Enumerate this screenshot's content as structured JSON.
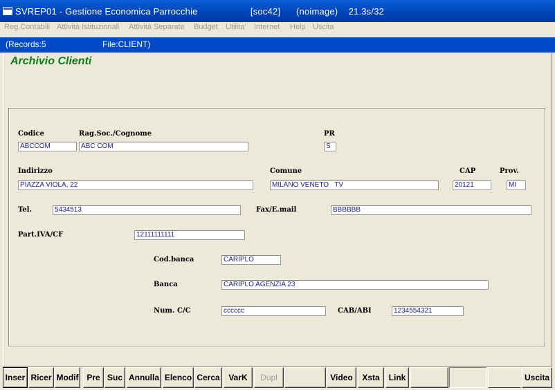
{
  "window": {
    "title": "SVREP01 - Gestione Economica Parrocchie                    [soc42]      (noimage)    21.3s/32"
  },
  "menu": [
    "Reg.Contabili",
    "Attività Istituzionali",
    "Attività Separate",
    "Budget",
    "Utilita'",
    "Internet",
    "Help",
    "Uscita"
  ],
  "info": {
    "records": "(Records:5",
    "file": "File:CLIENT)"
  },
  "form": {
    "title": "Archivio Clienti",
    "labels": {
      "codice": "Codice",
      "ragsoc": "Rag.Soc./Cognome",
      "pr": "PR",
      "indirizzo": "Indirizzo",
      "comune": "Comune",
      "cap": "CAP",
      "prov": "Prov.",
      "tel": "Tel.",
      "fax": "Fax/E.mail",
      "piva": "Part.IVA/CF",
      "codbanca": "Cod.banca",
      "banca": "Banca",
      "numcc": "Num. C/C",
      "cababi": "CAB/ABI"
    },
    "values": {
      "codice": "ABCCOM",
      "ragsoc": "ABC COM",
      "pr": "S",
      "indirizzo": "PIAZZA VIOLA, 22",
      "comune": "MILANO VENETO   TV",
      "cap": "20121",
      "prov": "MI",
      "tel": "5434513",
      "fax": "BBBBBB",
      "piva": "12111111111",
      "codbanca": "CARIPLO",
      "banca": "CARIPLO AGENZIA 23",
      "numcc": "cccccc",
      "cababi": "1234554321"
    }
  },
  "buttons": {
    "inser": "Inser",
    "ricer": "Ricer",
    "modif": "Modif",
    "pre": "Pre",
    "suc": "Suc",
    "annulla": "Annulla",
    "elenco": "Elenco",
    "cerca": "Cerca",
    "vark": "VarK",
    "dupl": "Dupl",
    "blank1": "",
    "video": "Video",
    "xsta": "Xsta",
    "link": "Link",
    "blank2": "",
    "blank3": "",
    "blank4": "",
    "uscita": "Uscita"
  }
}
